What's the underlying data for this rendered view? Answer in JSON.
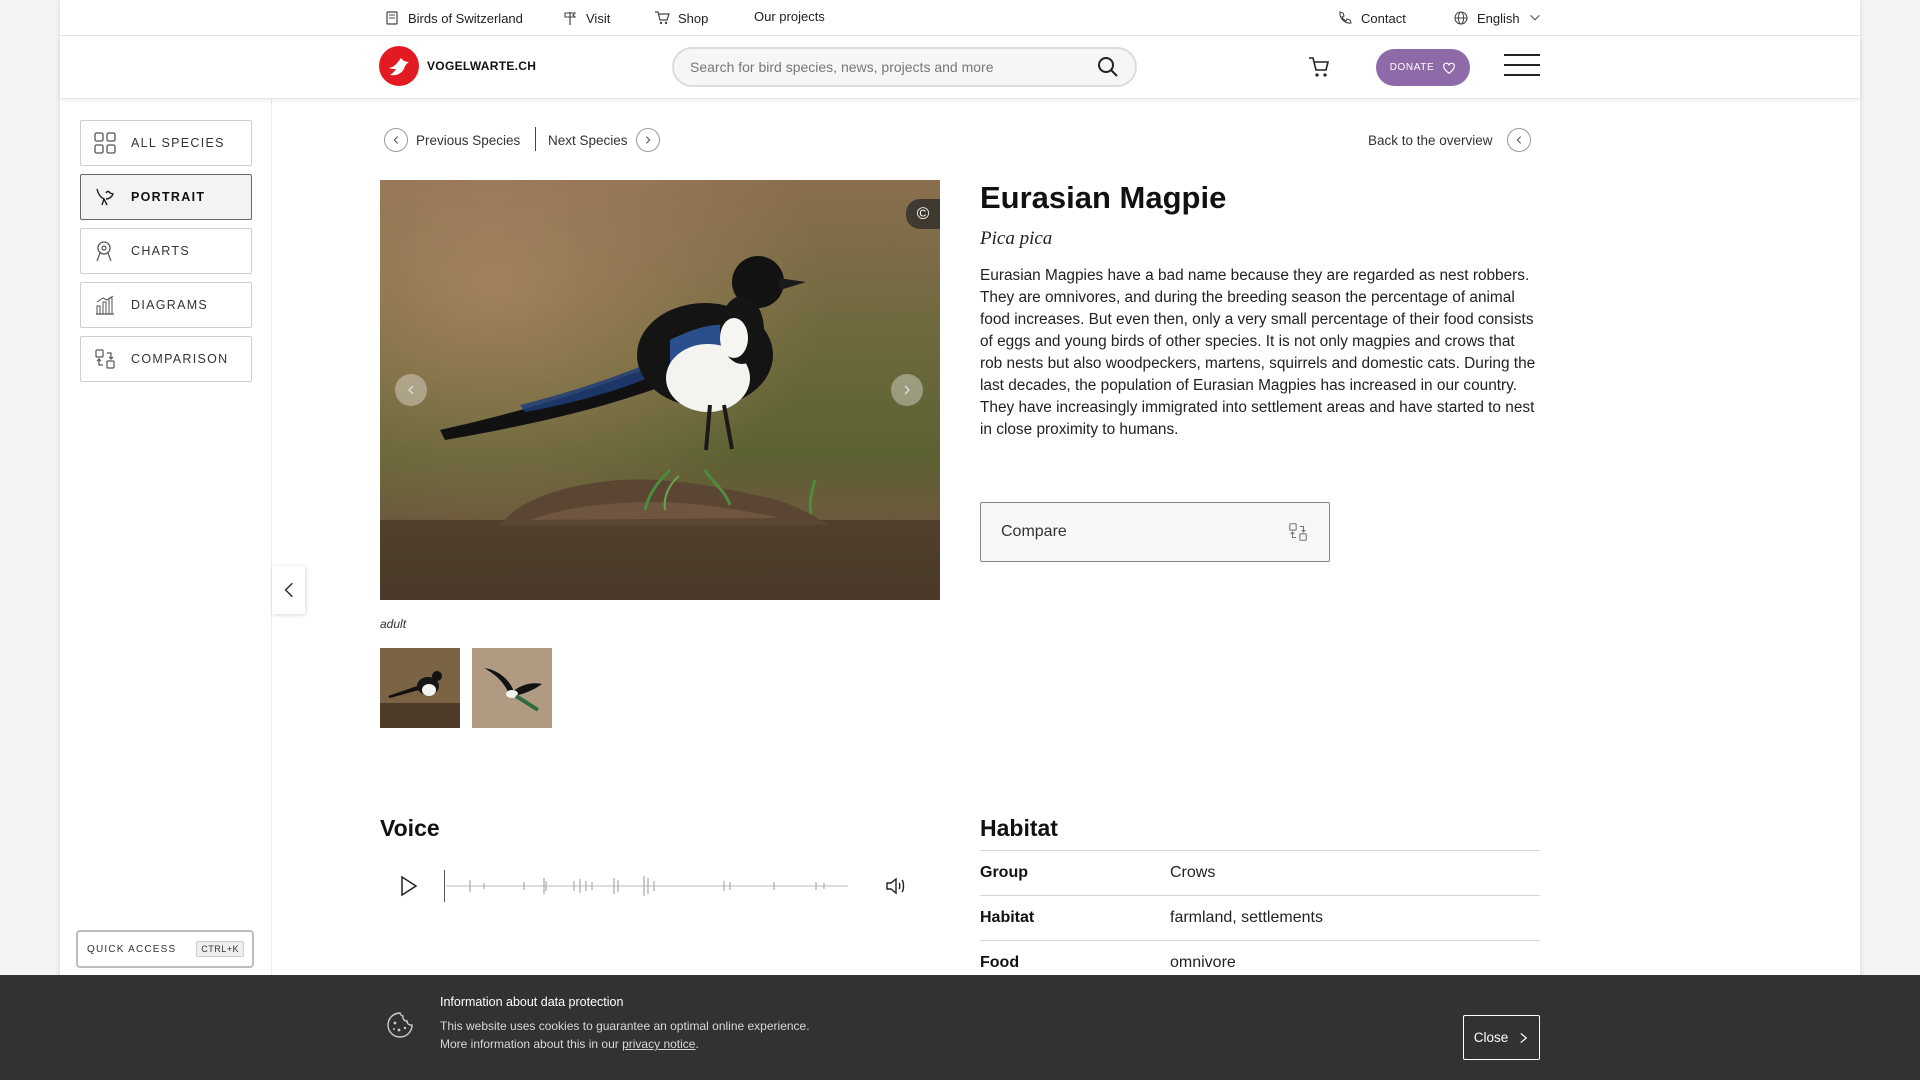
{
  "topbar": {
    "birds_label": "Birds of Switzerland",
    "visit_label": "Visit",
    "shop_label": "Shop",
    "projects_label": "Our projects",
    "contact_label": "Contact",
    "language_label": "English"
  },
  "header": {
    "logo_text": "VOGELWARTE.CH",
    "search_placeholder": "Search for bird species, news, projects and more",
    "donate_label": "DONATE"
  },
  "sidebar": {
    "items": [
      {
        "label": "ALL SPECIES",
        "icon": "grid-icon"
      },
      {
        "label": "PORTRAIT",
        "icon": "bird-icon",
        "active": true
      },
      {
        "label": "CHARTS",
        "icon": "map-pin-icon"
      },
      {
        "label": "DIAGRAMS",
        "icon": "bar-chart-icon"
      },
      {
        "label": "COMPARISON",
        "icon": "compare-icon"
      }
    ],
    "quick_access_label": "QUICK ACCESS",
    "quick_access_shortcut": "CTRL+K"
  },
  "species_nav": {
    "previous_label": "Previous Species",
    "next_label": "Next Species",
    "back_label": "Back to the overview"
  },
  "gallery": {
    "copyright_symbol": "©",
    "caption": "adult",
    "thumbnails": [
      "magpie-perched-thumbnail",
      "magpie-flying-thumbnail"
    ]
  },
  "species": {
    "name": "Eurasian Magpie",
    "latin_name": "Pica pica",
    "description": "Eurasian Magpies have a bad name because they are regarded as nest robbers. They are omnivores, and during the breeding season the percentage of animal food increases. But even then, only a very small percentage of their food consists of eggs and young birds of other species. It is not only magpies and crows that rob nests but also woodpeckers, martens, squirrels and domestic cats. During the last decades, the population of Eurasian Magpies has increased in our country. They have increasingly immigrated into settlement areas and have started to nest in close proximity to humans.",
    "compare_label": "Compare"
  },
  "voice": {
    "heading": "Voice"
  },
  "habitat": {
    "heading": "Habitat",
    "rows": [
      {
        "key": "Group",
        "value": "Crows"
      },
      {
        "key": "Habitat",
        "value": "farmland, settlements"
      },
      {
        "key": "Food",
        "value": "omnivore"
      }
    ]
  },
  "cookie_banner": {
    "title": "Information about data protection",
    "line1": "This website uses cookies to guarantee an optimal online experience.",
    "line2_prefix": "More information about this in our ",
    "link_text": "privacy notice",
    "line2_suffix": ".",
    "close_label": "Close"
  },
  "colors": {
    "brand_red": "#e21b23",
    "donate_purple": "#8f6aa8",
    "cookie_bg": "#323232"
  }
}
